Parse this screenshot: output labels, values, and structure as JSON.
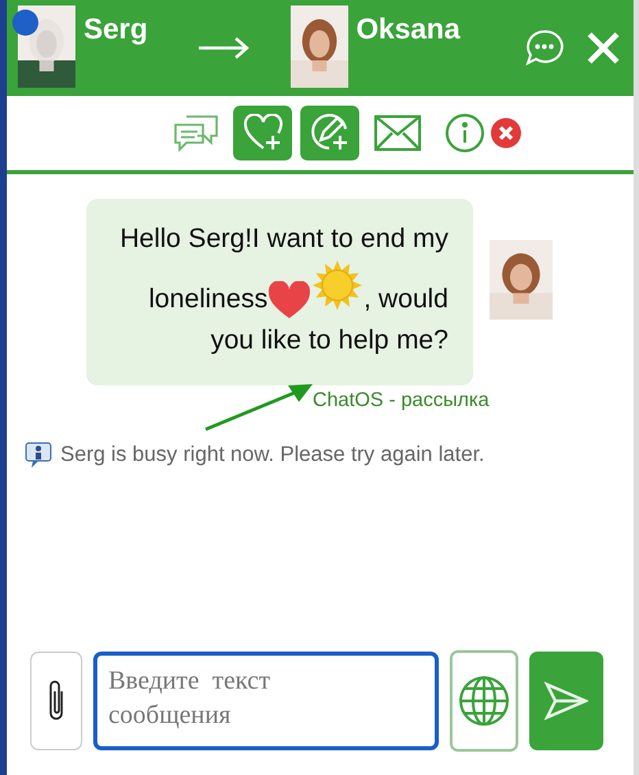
{
  "header": {
    "sender": {
      "name": "Serg"
    },
    "recipient": {
      "name": "Oksana"
    }
  },
  "toolbar": [
    {
      "kind": "chats",
      "highlighted": false
    },
    {
      "kind": "heart-plus",
      "highlighted": true
    },
    {
      "kind": "pen-plus",
      "highlighted": true
    },
    {
      "kind": "mail",
      "highlighted": false
    },
    {
      "kind": "info",
      "highlighted": false
    },
    {
      "kind": "remove",
      "highlighted": false
    }
  ],
  "message": {
    "parts": [
      {
        "kind": "text",
        "text": "Hello Serg!I want to end my"
      },
      {
        "kind": "break"
      },
      {
        "kind": "text",
        "text": "loneliness"
      },
      {
        "kind": "heart"
      },
      {
        "kind": "sun"
      },
      {
        "kind": "text",
        "text": ", would"
      },
      {
        "kind": "break"
      },
      {
        "kind": "text",
        "text": "you like to help me?"
      }
    ],
    "source": "ChatOS - рассылка"
  },
  "notice": "Serg is busy right now. Please try again later.",
  "composer": {
    "placeholder": "Введите  текст сообщения",
    "focused": true
  }
}
